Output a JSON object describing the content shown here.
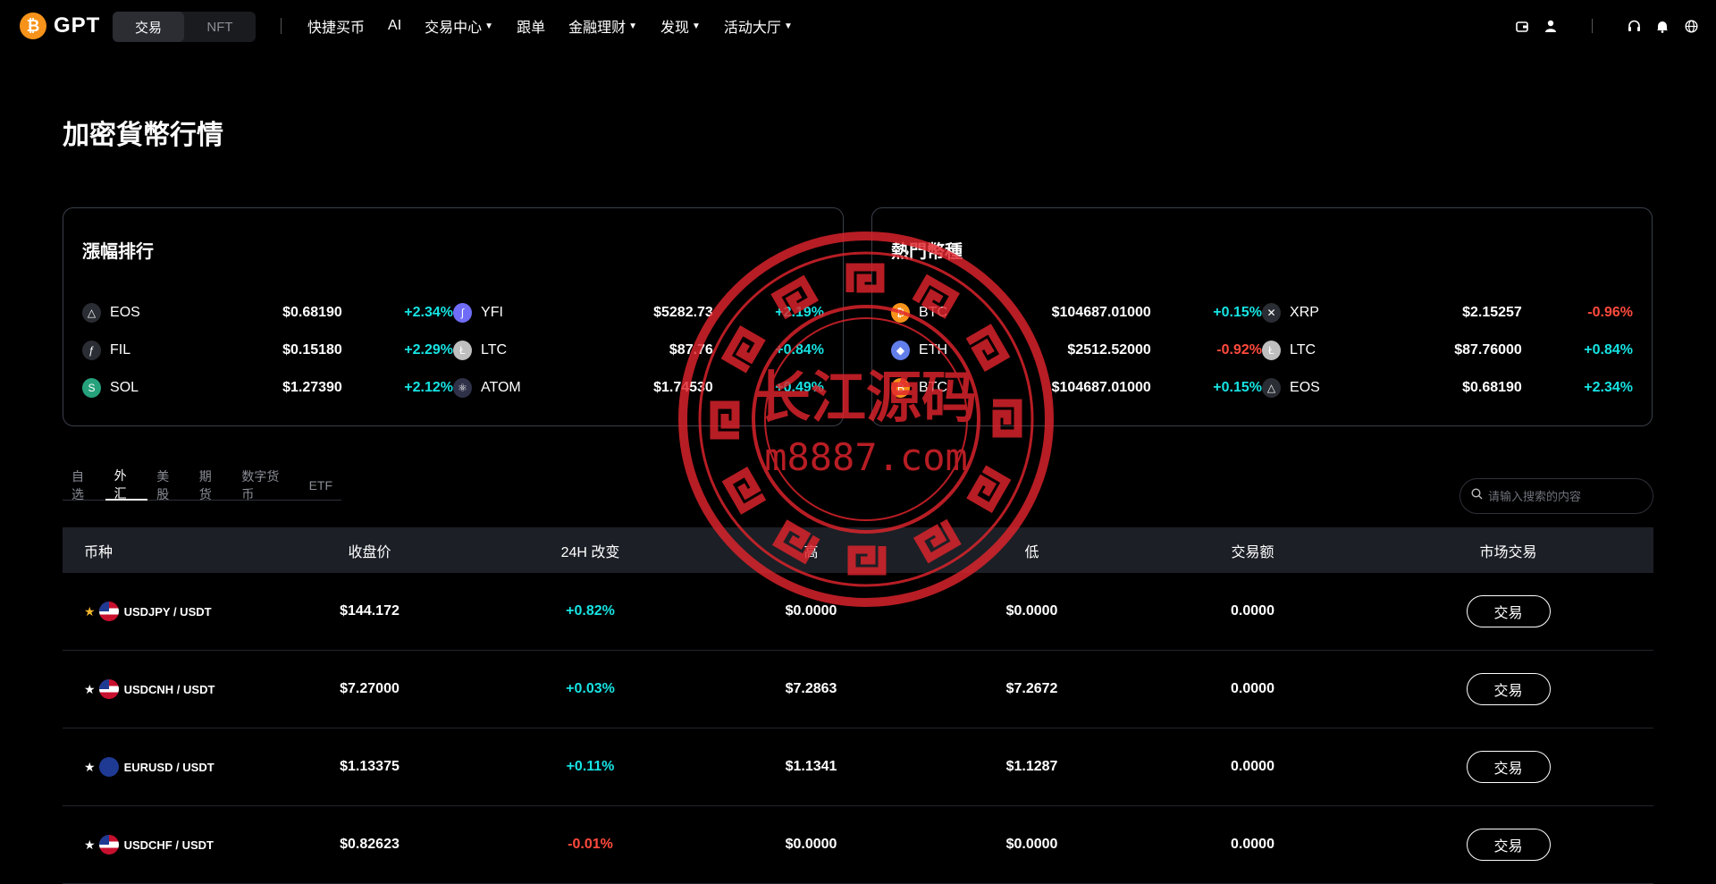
{
  "brand": {
    "name": "GPT",
    "coin_glyph": "₿",
    "accent": "#f7931a"
  },
  "segment": {
    "options": [
      "交易",
      "NFT"
    ],
    "active": 0
  },
  "nav": [
    {
      "label": "快捷买币",
      "dropdown": false
    },
    {
      "label": "AI",
      "dropdown": false
    },
    {
      "label": "交易中心",
      "dropdown": true
    },
    {
      "label": "跟单",
      "dropdown": false
    },
    {
      "label": "金融理财",
      "dropdown": true
    },
    {
      "label": "发现",
      "dropdown": true
    },
    {
      "label": "活动大厅",
      "dropdown": true
    }
  ],
  "right_icons": [
    "wallet-icon",
    "user-icon",
    "headset-icon",
    "bell-icon",
    "globe-icon"
  ],
  "page_title": "加密貨幣行情",
  "gainers": {
    "title": "漲幅排行",
    "items": [
      {
        "symbol": "EOS",
        "price": "$0.68190",
        "change": "+2.34%",
        "dir": "up",
        "icon": "eos-icon",
        "color": "#2a2d33"
      },
      {
        "symbol": "YFI",
        "price": "$5282.73",
        "change": "+2.19%",
        "dir": "up",
        "icon": "yfi-icon",
        "color": "#6f6cf7"
      },
      {
        "symbol": "FIL",
        "price": "$0.15180",
        "change": "+2.29%",
        "dir": "up",
        "icon": "fil-icon",
        "color": "#2a2d33"
      },
      {
        "symbol": "LTC",
        "price": "$87.76",
        "change": "+0.84%",
        "dir": "up",
        "icon": "ltc-icon",
        "color": "#bfbfbf"
      },
      {
        "symbol": "SOL",
        "price": "$1.27390",
        "change": "+2.12%",
        "dir": "up",
        "icon": "sol-icon",
        "color": "#26a17b"
      },
      {
        "symbol": "ATOM",
        "price": "$1.74530",
        "change": "+0.49%",
        "dir": "up",
        "icon": "atom-icon",
        "color": "#2e3148"
      }
    ]
  },
  "popular": {
    "title": "熱門幣種",
    "items": [
      {
        "symbol": "BTC",
        "price": "$104687.01000",
        "change": "+0.15%",
        "dir": "up",
        "icon": "btc-icon",
        "color": "#f7931a"
      },
      {
        "symbol": "XRP",
        "price": "$2.15257",
        "change": "-0.96%",
        "dir": "down",
        "icon": "xrp-icon",
        "color": "#2a2d33"
      },
      {
        "symbol": "ETH",
        "price": "$2512.52000",
        "change": "-0.92%",
        "dir": "down",
        "icon": "eth-icon",
        "color": "#627eea"
      },
      {
        "symbol": "LTC",
        "price": "$87.76000",
        "change": "+0.84%",
        "dir": "up",
        "icon": "ltc-icon",
        "color": "#bfbfbf"
      },
      {
        "symbol": "BTC",
        "price": "$104687.01000",
        "change": "+0.15%",
        "dir": "up",
        "icon": "btc-icon",
        "color": "#f7931a"
      },
      {
        "symbol": "EOS",
        "price": "$0.68190",
        "change": "+2.34%",
        "dir": "up",
        "icon": "eos-icon",
        "color": "#2a2d33"
      }
    ]
  },
  "tabs": {
    "items": [
      "自选",
      "外汇",
      "美股",
      "期货",
      "数字货币",
      "ETF"
    ],
    "active": 1
  },
  "search": {
    "placeholder": "请输入搜索的内容"
  },
  "table": {
    "columns": [
      "币种",
      "收盘价",
      "24H 改变",
      "高",
      "低",
      "交易额",
      "市场交易"
    ],
    "rows": [
      {
        "pair": "USDJPY / USDT",
        "starred": true,
        "flag": "us",
        "close": "$144.172",
        "change": "+0.82%",
        "dir": "up",
        "high": "$0.0000",
        "low": "$0.0000",
        "volume": "0.0000",
        "action": "交易"
      },
      {
        "pair": "USDCNH / USDT",
        "starred": false,
        "flag": "us",
        "close": "$7.27000",
        "change": "+0.03%",
        "dir": "up",
        "high": "$7.2863",
        "low": "$7.2672",
        "volume": "0.0000",
        "action": "交易"
      },
      {
        "pair": "EURUSD / USDT",
        "starred": false,
        "flag": "eu",
        "close": "$1.13375",
        "change": "+0.11%",
        "dir": "up",
        "high": "$1.1341",
        "low": "$1.1287",
        "volume": "0.0000",
        "action": "交易"
      },
      {
        "pair": "USDCHF / USDT",
        "starred": false,
        "flag": "us",
        "close": "$0.82623",
        "change": "-0.01%",
        "dir": "down",
        "high": "$0.0000",
        "low": "$0.0000",
        "volume": "0.0000",
        "action": "交易"
      }
    ]
  },
  "watermark": {
    "line1": "长江源码",
    "line2": "m8887.com",
    "color": "#e0242c"
  },
  "colors": {
    "up": "#17e3e3",
    "down": "#ff4a3d",
    "star_active": "#f5b82e"
  }
}
